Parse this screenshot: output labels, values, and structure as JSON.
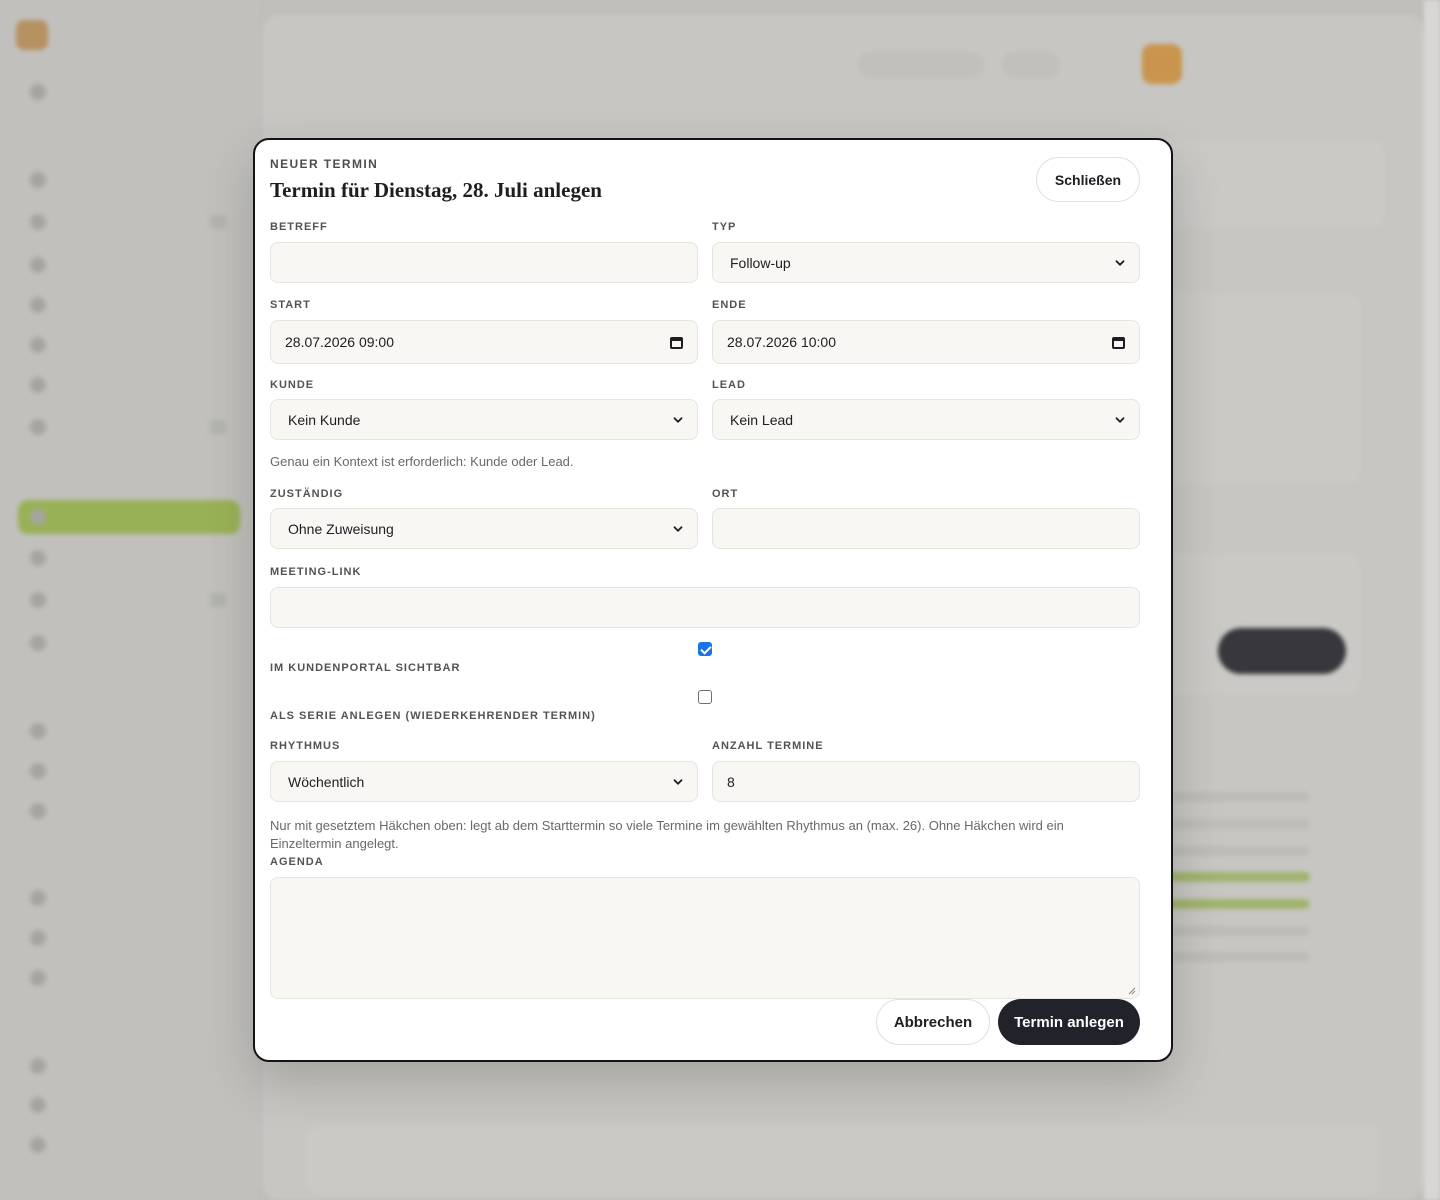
{
  "modal": {
    "eyebrow": "NEUER TERMIN",
    "title": "Termin für Dienstag, 28. Juli anlegen",
    "close_label": "Schließen",
    "fields": {
      "subject": {
        "label": "BETREFF",
        "value": ""
      },
      "type": {
        "label": "TYP",
        "value": "Follow-up"
      },
      "start": {
        "label": "START",
        "value": "28.07.2026 09:00"
      },
      "end": {
        "label": "ENDE",
        "value": "28.07.2026 10:00"
      },
      "customer": {
        "label": "KUNDE",
        "value": "Kein Kunde"
      },
      "lead": {
        "label": "LEAD",
        "value": "Kein Lead"
      },
      "context_hint": "Genau ein Kontext ist erforderlich: Kunde oder Lead.",
      "owner": {
        "label": "ZUSTÄNDIG",
        "value": "Ohne Zuweisung"
      },
      "location": {
        "label": "ORT",
        "value": ""
      },
      "meeting_link": {
        "label": "MEETING-LINK",
        "value": ""
      },
      "portal_visible": {
        "label": "IM KUNDENPORTAL SICHTBAR",
        "checked": true
      },
      "series": {
        "label": "ALS SERIE ANLEGEN (WIEDERKEHRENDER TERMIN)",
        "checked": false
      },
      "rhythm": {
        "label": "RHYTHMUS",
        "value": "Wöchentlich"
      },
      "count": {
        "label": "ANZAHL TERMINE",
        "value": "8"
      },
      "series_hint": "Nur mit gesetztem Häkchen oben: legt ab dem Starttermin so viele Termine im gewählten Rhythmus an (max. 26). Ohne Häkchen wird ein Einzeltermin angelegt.",
      "agenda": {
        "label": "AGENDA",
        "value": ""
      }
    },
    "cancel_label": "Abbrechen",
    "submit_label": "Termin anlegen"
  },
  "colors": {
    "primary_button": "#22222a",
    "checkbox_checked": "#1a73e8",
    "field_background": "#f8f7f3",
    "sidebar_active": "#a9c45e"
  },
  "icons": [
    "chevron-down-icon",
    "calendar-icon",
    "checkbox-checked",
    "checkbox-unchecked"
  ]
}
